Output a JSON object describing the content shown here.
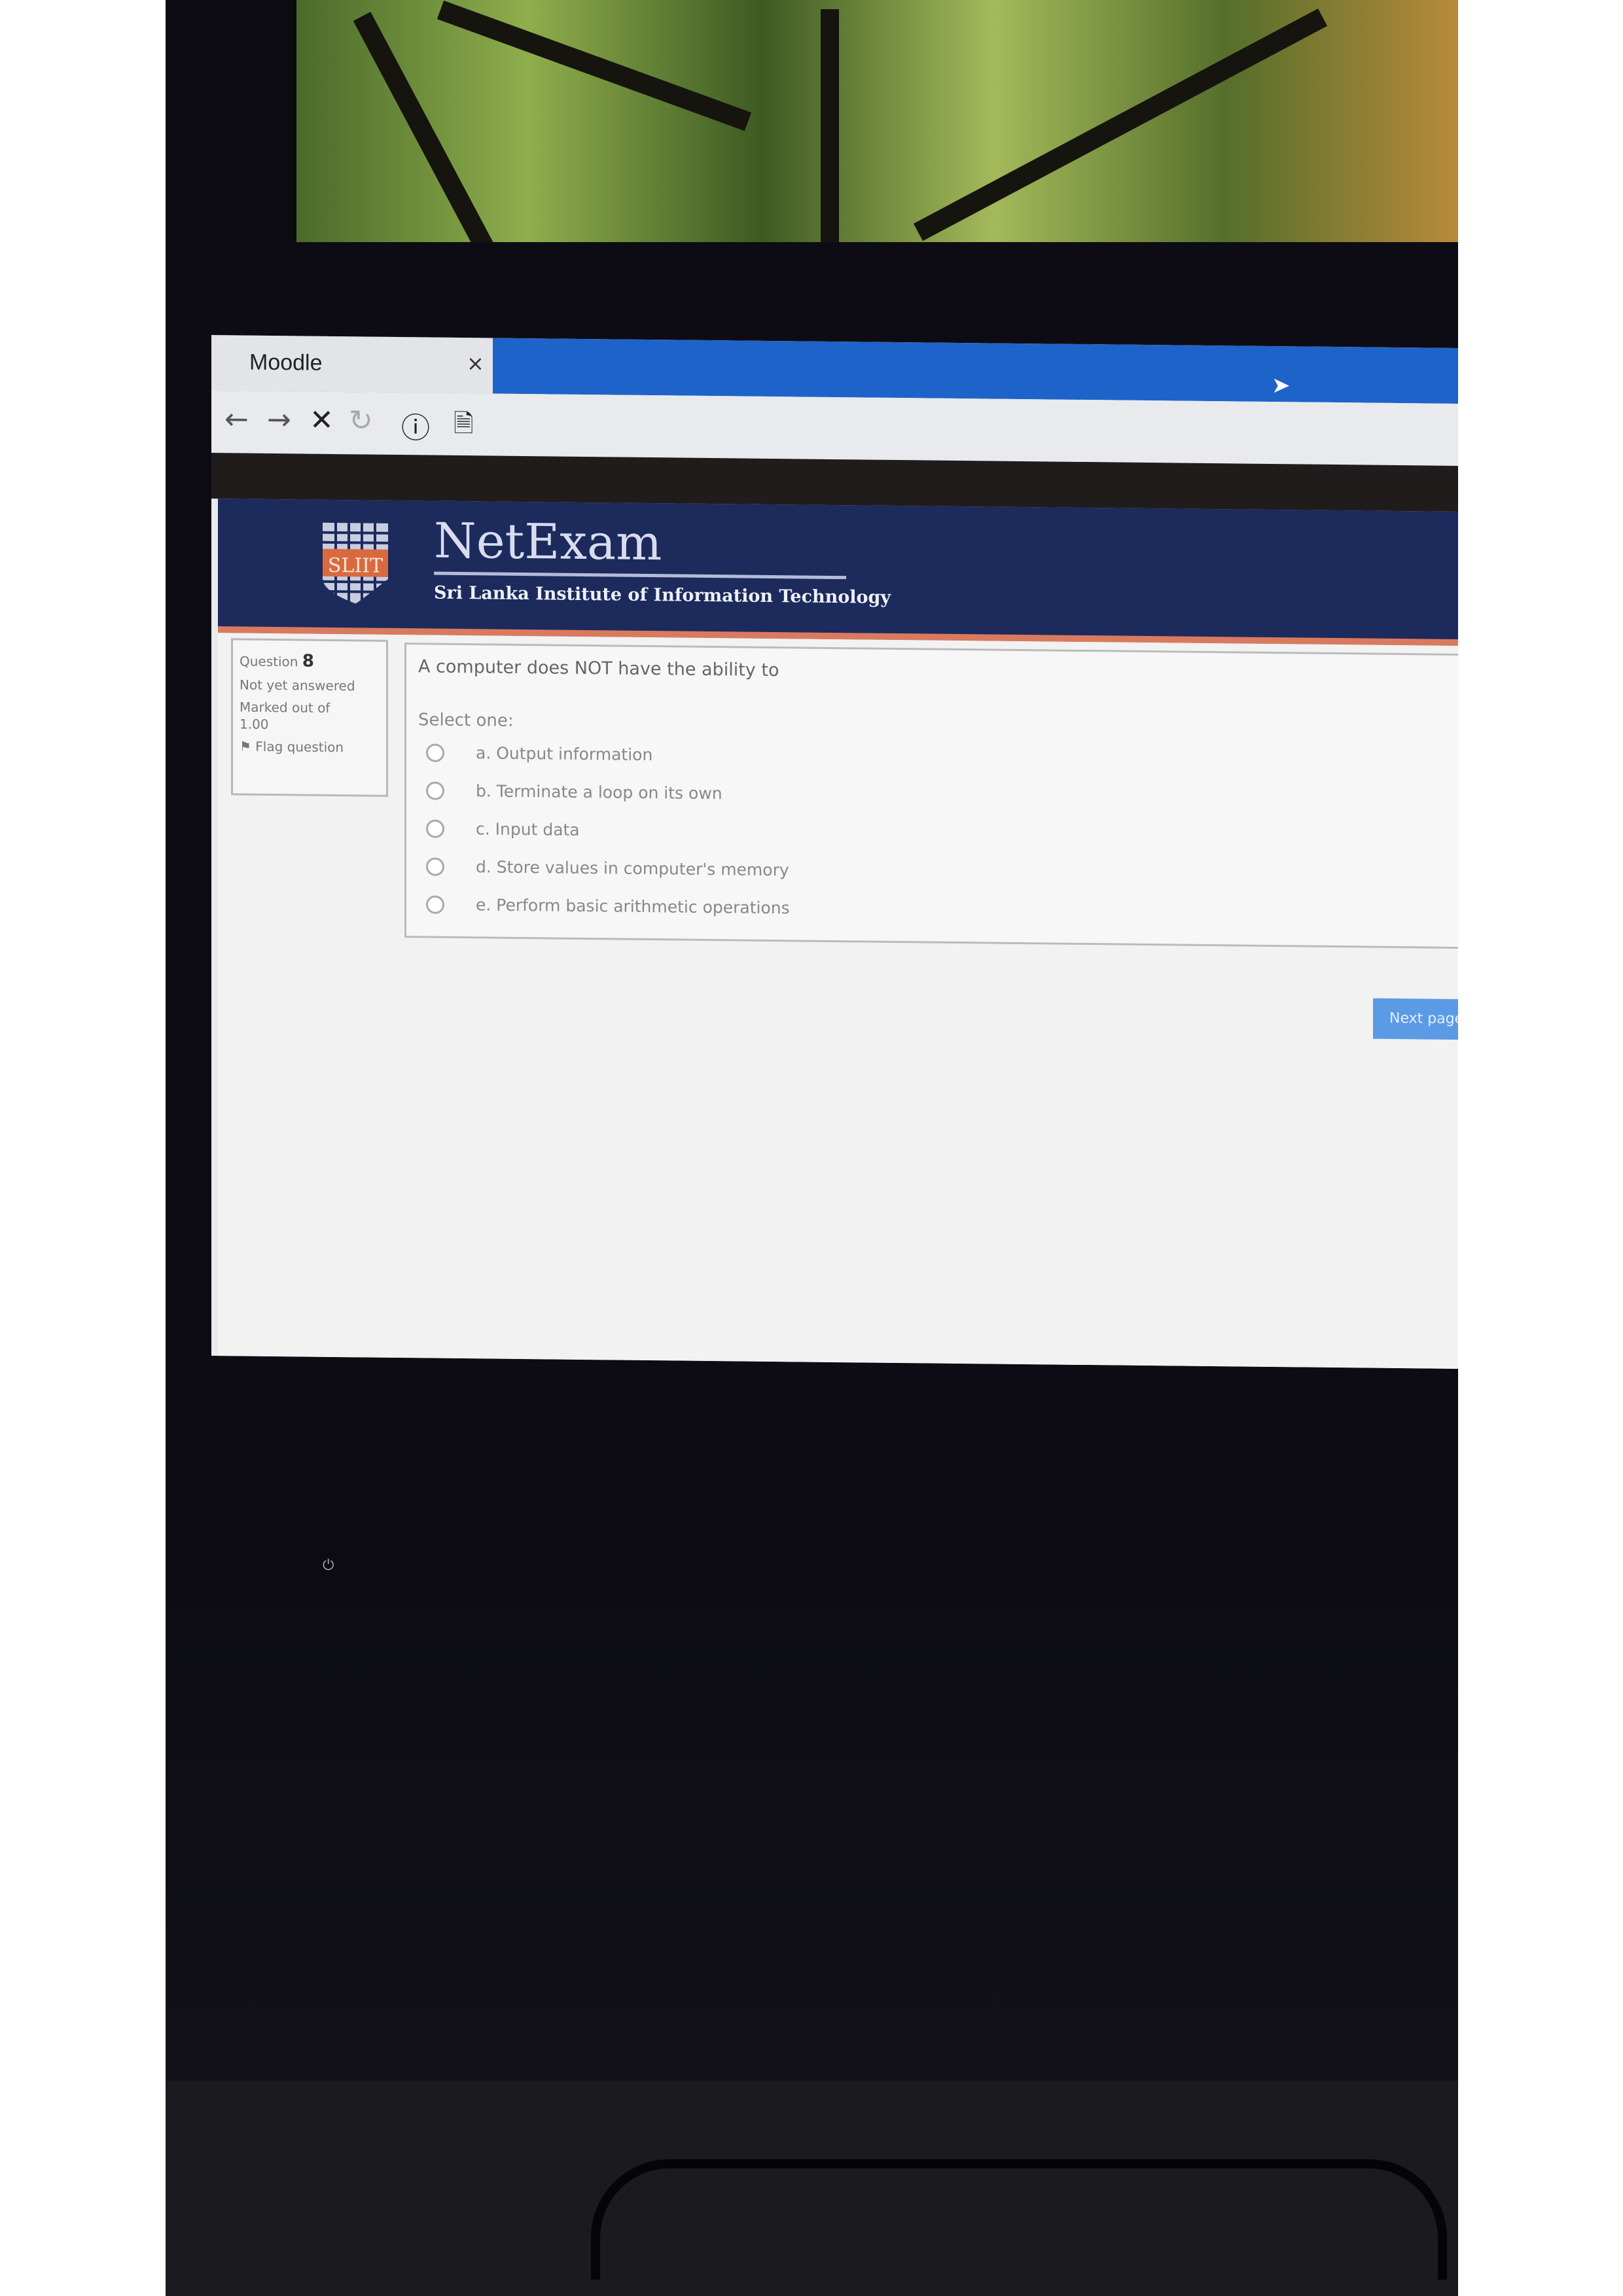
{
  "browser": {
    "tab_title": "Moodle",
    "tab_close": "×",
    "toolbar_icons": [
      "back-arrow-icon",
      "forward-arrow-icon",
      "stop-icon",
      "reload-icon",
      "info-icon",
      "page-icon"
    ],
    "glyphs": {
      "back": "←",
      "forward": "→",
      "stop": "✕",
      "reload": "↻",
      "info": "ⓘ",
      "page": "🗎"
    }
  },
  "header": {
    "brand": "NetExam",
    "subtitle": "Sri Lanka Institute of Information Technology",
    "logo_text": "SLIIT",
    "colors": {
      "header_bg": "#1c2a5c",
      "accent_stripe": "#d97a5e"
    }
  },
  "question_info": {
    "label": "Question",
    "number": "8",
    "status": "Not yet answered",
    "marked": "Marked out of",
    "marks": "1.00",
    "flag": "Flag question"
  },
  "question": {
    "text": "A computer does NOT have the ability to",
    "prompt": "Select one:",
    "options": [
      "a. Output information",
      "b. Terminate a loop on its own",
      "c. Input data",
      "d. Store values in computer's memory",
      "e. Perform basic arithmetic operations"
    ]
  },
  "nav": {
    "next_label": "Next page",
    "color": "#5b9be6"
  }
}
